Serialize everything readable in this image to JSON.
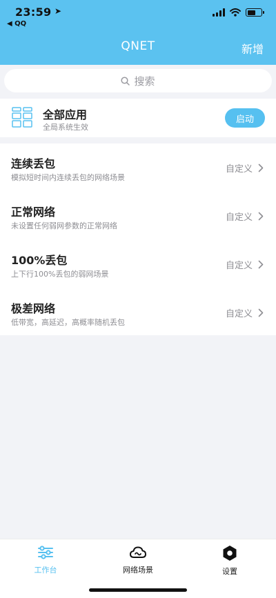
{
  "status_bar": {
    "time": "23:59",
    "back_label": "◀ QQ"
  },
  "nav": {
    "title": "QNET",
    "add_label": "新增"
  },
  "search": {
    "placeholder": "搜索"
  },
  "all_apps": {
    "title": "全部应用",
    "subtitle": "全局系统生效",
    "start_label": "启动"
  },
  "scenes": [
    {
      "name": "连续丢包",
      "desc": "模拟短时间内连续丢包的网络场景",
      "action": "自定义"
    },
    {
      "name": "正常网络",
      "desc": "未设置任何弱网参数的正常网络",
      "action": "自定义"
    },
    {
      "name": "100%丢包",
      "desc": "上下行100%丢包的弱网场景",
      "action": "自定义"
    },
    {
      "name": "极差网络",
      "desc": "低带宽，高延迟，高概率随机丢包",
      "action": "自定义"
    }
  ],
  "tabbar": {
    "items": [
      {
        "label": "工作台",
        "icon": "sliders-icon",
        "active": true
      },
      {
        "label": "网络场景",
        "icon": "cloud-icon",
        "active": false
      },
      {
        "label": "设置",
        "icon": "hexagon-gear-icon",
        "active": false
      }
    ]
  },
  "colors": {
    "accent": "#5bc2f0",
    "background": "#f2f3f7",
    "secondary_text": "#8e8e93"
  }
}
